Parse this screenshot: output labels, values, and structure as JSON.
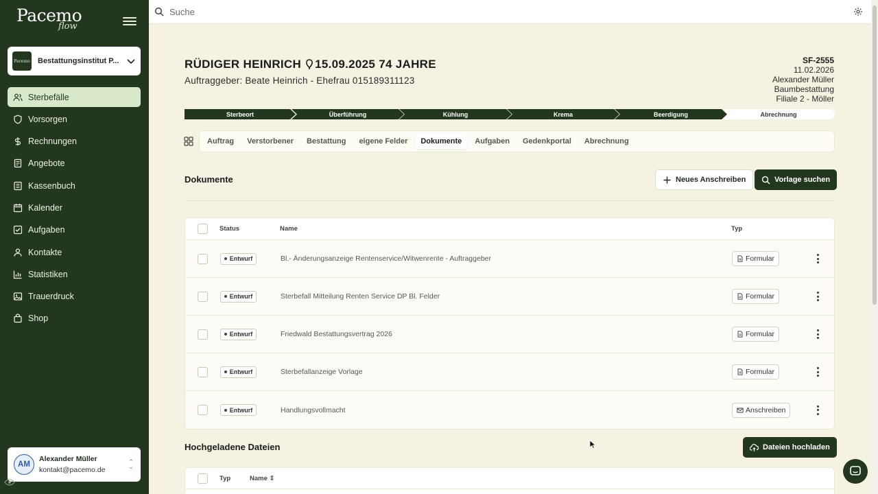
{
  "brand": {
    "name": "Pacemo",
    "sub": "flow"
  },
  "org": {
    "name": "Bestattungsinstitut P...",
    "logo_text": "Pacemo"
  },
  "nav": [
    {
      "label": "Sterbefälle",
      "icon": "users-icon",
      "active": true
    },
    {
      "label": "Vorsorgen",
      "icon": "shield-icon"
    },
    {
      "label": "Rechnungen",
      "icon": "dollar-icon"
    },
    {
      "label": "Angebote",
      "icon": "document-icon"
    },
    {
      "label": "Kassenbuch",
      "icon": "ledger-icon"
    },
    {
      "label": "Kalender",
      "icon": "calendar-icon"
    },
    {
      "label": "Aufgaben",
      "icon": "checkbox-icon"
    },
    {
      "label": "Kontakte",
      "icon": "contacts-icon"
    },
    {
      "label": "Statistiken",
      "icon": "bar-chart-icon"
    },
    {
      "label": "Trauerdruck",
      "icon": "image-icon"
    },
    {
      "label": "Shop",
      "icon": "shopping-bag-icon"
    }
  ],
  "user": {
    "initials": "AM",
    "name": "Alexander Müller",
    "email": "kontakt@pacemo.de"
  },
  "search": {
    "placeholder": "Suche"
  },
  "case": {
    "name": "RÜDIGER HEINRICH",
    "date": "15.09.2025",
    "age": "74 JAHRE",
    "client_line": "Auftraggeber: Beate Heinrich - Ehefrau  015189311123",
    "id": "SF-2555",
    "created": "11.02.2026",
    "owner": "Alexander Müller",
    "burial_type": "Baumbestattung",
    "branch": "Filiale 2 - Möller"
  },
  "steps": [
    {
      "label": "Sterbeort",
      "done": true
    },
    {
      "label": "Überführung",
      "done": true
    },
    {
      "label": "Kühlung",
      "done": true
    },
    {
      "label": "Krema",
      "done": true
    },
    {
      "label": "Beerdigung",
      "done": true
    },
    {
      "label": "Abrechnung",
      "done": false
    }
  ],
  "tabs": [
    {
      "label": "Auftrag"
    },
    {
      "label": "Verstorbener"
    },
    {
      "label": "Bestattung"
    },
    {
      "label": "eigene Felder"
    },
    {
      "label": "Dokumente",
      "active": true
    },
    {
      "label": "Aufgaben"
    },
    {
      "label": "Gedenkportal"
    },
    {
      "label": "Abrechnung"
    }
  ],
  "documents": {
    "title": "Dokumente",
    "new_button": "Neues Anschreiben",
    "template_button": "Vorlage suchen",
    "columns": {
      "status": "Status",
      "name": "Name",
      "type": "Typ"
    },
    "rows": [
      {
        "status": "Entwurf",
        "name": "Bl.- Änderungsanzeige Rentenservice/Witwenrente - Auftraggeber",
        "type": "Formular",
        "type_icon": "form-icon"
      },
      {
        "status": "Entwurf",
        "name": "Sterbefall Mitteilung Renten Service DP Bl. Felder",
        "type": "Formular",
        "type_icon": "form-icon"
      },
      {
        "status": "Entwurf",
        "name": "Friedwald Bestattungsvertrag 2026",
        "type": "Formular",
        "type_icon": "form-icon"
      },
      {
        "status": "Entwurf",
        "name": "Sterbefallanzeige Vorlage",
        "type": "Formular",
        "type_icon": "form-icon"
      },
      {
        "status": "Entwurf",
        "name": "Handlungsvollmacht",
        "type": "Anschreiben",
        "type_icon": "mail-icon"
      }
    ]
  },
  "uploads": {
    "title": "Hochgeladene Dateien",
    "upload_button": "Dateien hochladen",
    "columns": {
      "type": "Typ",
      "name": "Name ⇕"
    }
  }
}
